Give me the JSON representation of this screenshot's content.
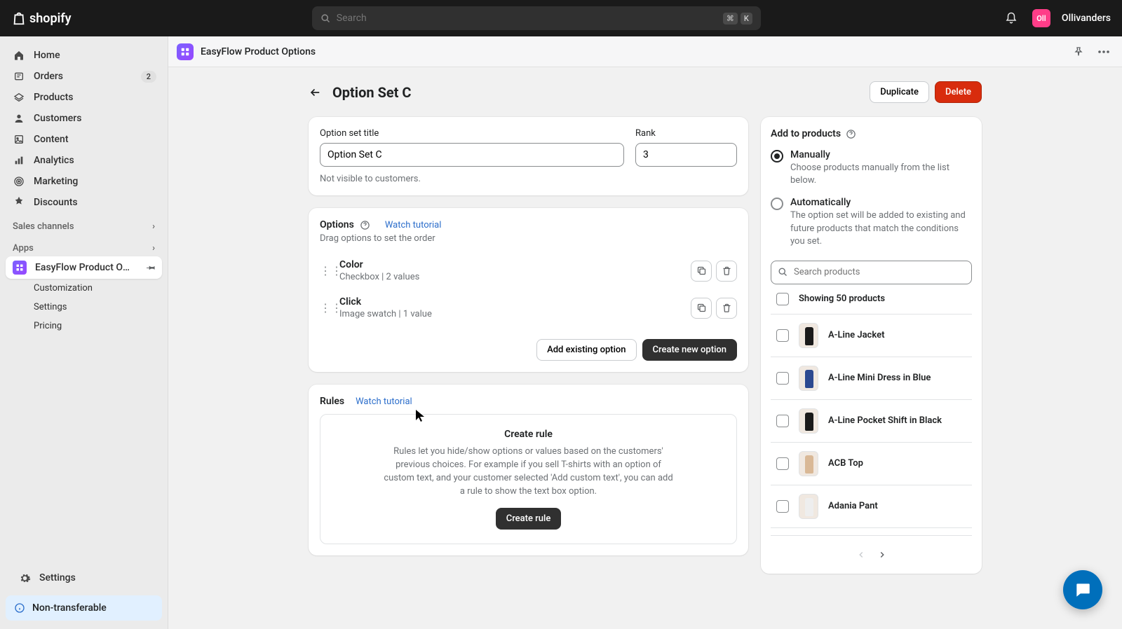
{
  "header": {
    "brand": "shopify",
    "search_placeholder": "Search",
    "shortcut_mod": "⌘",
    "shortcut_key": "K",
    "avatar_initials": "Oll",
    "username": "Ollivanders"
  },
  "sidebar": {
    "items": [
      {
        "label": "Home"
      },
      {
        "label": "Orders",
        "badge": "2"
      },
      {
        "label": "Products"
      },
      {
        "label": "Customers"
      },
      {
        "label": "Content"
      },
      {
        "label": "Analytics"
      },
      {
        "label": "Marketing"
      },
      {
        "label": "Discounts"
      }
    ],
    "sales_channels_label": "Sales channels",
    "apps_label": "Apps",
    "app_name": "EasyFlow Product Op…",
    "app_sub": [
      {
        "label": "Customization"
      },
      {
        "label": "Settings"
      },
      {
        "label": "Pricing"
      }
    ],
    "settings_label": "Settings",
    "banner_text": "Non-transferable"
  },
  "app_header": {
    "title": "EasyFlow Product Options"
  },
  "page": {
    "title": "Option Set C",
    "duplicate_label": "Duplicate",
    "delete_label": "Delete"
  },
  "form": {
    "title_label": "Option set title",
    "title_value": "Option Set C",
    "rank_label": "Rank",
    "rank_value": "3",
    "hint": "Not visible to customers."
  },
  "options_card": {
    "title": "Options",
    "watch_label": "Watch tutorial",
    "drag_hint": "Drag options to set the order",
    "items": [
      {
        "name": "Color",
        "meta": "Checkbox | 2 values"
      },
      {
        "name": "Click",
        "meta": "Image swatch | 1 value"
      }
    ],
    "add_existing_label": "Add existing option",
    "create_new_label": "Create new option"
  },
  "rules_card": {
    "title": "Rules",
    "watch_label": "Watch tutorial",
    "box_title": "Create rule",
    "box_desc": "Rules let you hide/show options or values based on the customers' previous choices. For example if you sell T-shirts with an option of custom text, and your customer selected 'Add custom text', you can add a rule to show the text box option.",
    "create_label": "Create rule"
  },
  "side_panel": {
    "title": "Add to products",
    "manual_label": "Manually",
    "manual_desc": "Choose products manually from the list below.",
    "auto_label": "Automatically",
    "auto_desc": "The option set will be added to existing and future products that match the conditions you set.",
    "search_placeholder": "Search products",
    "showing_label": "Showing 50 products",
    "products": [
      {
        "name": "A-Line Jacket",
        "variant": "black"
      },
      {
        "name": "A-Line Mini Dress in Blue",
        "variant": "blue"
      },
      {
        "name": "A-Line Pocket Shift in Black",
        "variant": "black"
      },
      {
        "name": "ACB Top",
        "variant": "beige"
      },
      {
        "name": "Adania Pant",
        "variant": "white"
      }
    ]
  }
}
